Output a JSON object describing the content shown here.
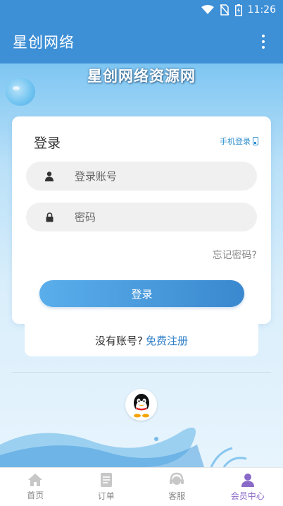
{
  "status_bar": {
    "time": "11:26"
  },
  "app_bar": {
    "title": "星创网络"
  },
  "hero": {
    "title": "星创网络资源网"
  },
  "login_card": {
    "title": "登录",
    "phone_login_label": "手机登录",
    "username_placeholder": "登录账号",
    "password_placeholder": "密码",
    "forgot_label": "忘记密码?",
    "login_button_label": "登录"
  },
  "register": {
    "prompt": "没有账号?",
    "link_label": "免费注册"
  },
  "tabs": [
    {
      "label": "首页",
      "icon": "home-icon"
    },
    {
      "label": "订单",
      "icon": "order-icon"
    },
    {
      "label": "客服",
      "icon": "service-icon"
    },
    {
      "label": "会员中心",
      "icon": "member-icon"
    }
  ],
  "colors": {
    "primary": "#3d8fd6",
    "link": "#2f7fc7",
    "active_tab": "#8a6ac8"
  }
}
